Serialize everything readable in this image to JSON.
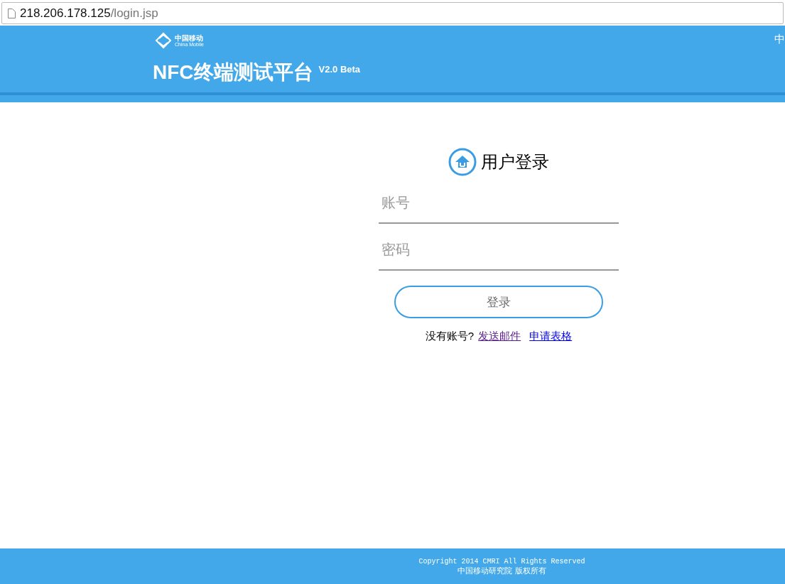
{
  "address_bar": {
    "host": "218.206.178.125",
    "path": "/login.jsp"
  },
  "header": {
    "logo_cn": "中国移动",
    "logo_en": "China Mobile",
    "title": "NFC终端测试平台",
    "version": "V2.0 Beta",
    "language": "中"
  },
  "login": {
    "heading": "用户登录",
    "account": {
      "placeholder": "账号"
    },
    "password": {
      "placeholder": "密码"
    },
    "submit": "登录",
    "prompt": "没有账号?",
    "links": [
      {
        "label": "发送邮件",
        "visited": true
      },
      {
        "label": "申请表格",
        "visited": false
      }
    ]
  },
  "footer": {
    "copyright": "Copyright 2014 CMRI All Rights Reserved",
    "owner": "中国移动研究院 版权所有"
  }
}
